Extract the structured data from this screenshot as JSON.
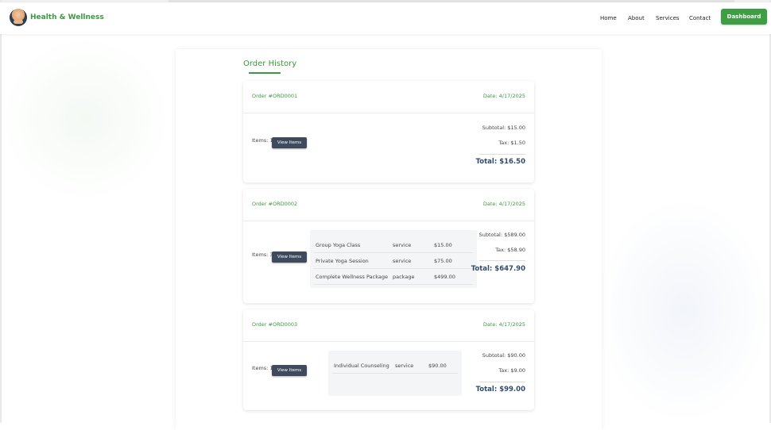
{
  "brand": {
    "name": "Health & Wellness",
    "logo_icon": "meditation-logo-icon"
  },
  "nav": {
    "links": [
      "Home",
      "About",
      "Services",
      "Contact"
    ],
    "dashboard_label": "Dashboard"
  },
  "page": {
    "title": "Order History"
  },
  "colors": {
    "accent": "#3a9a3e",
    "button_dark": "#3f4a5c",
    "total_text": "#2f4b6e"
  },
  "orders": [
    {
      "id": "Order #ORD0001",
      "date": "Date: 4/17/2025",
      "items_label": "Items: 1",
      "view_label": "View Items",
      "items": [],
      "subtotal": "Subtotal: $15.00",
      "tax": "Tax: $1.50",
      "total": "Total: $16.50"
    },
    {
      "id": "Order #ORD0002",
      "date": "Date: 4/17/2025",
      "items_label": "Items: 3",
      "view_label": "View Items",
      "items": [
        {
          "name": "Group Yoga Class",
          "type": "service",
          "price": "$15.00"
        },
        {
          "name": "Private Yoga Session",
          "type": "service",
          "price": "$75.00"
        },
        {
          "name": "Complete Wellness Package",
          "type": "package",
          "price": "$499.00"
        }
      ],
      "subtotal": "Subtotal: $589.00",
      "tax": "Tax: $58.90",
      "total": "Total: $647.90"
    },
    {
      "id": "Order #ORD0003",
      "date": "Date: 4/17/2025",
      "items_label": "Items: 1",
      "view_label": "View Items",
      "items": [
        {
          "name": "Individual Counseling",
          "type": "service",
          "price": "$90.00"
        }
      ],
      "subtotal": "Subtotal: $90.00",
      "tax": "Tax: $9.00",
      "total": "Total: $99.00"
    }
  ]
}
